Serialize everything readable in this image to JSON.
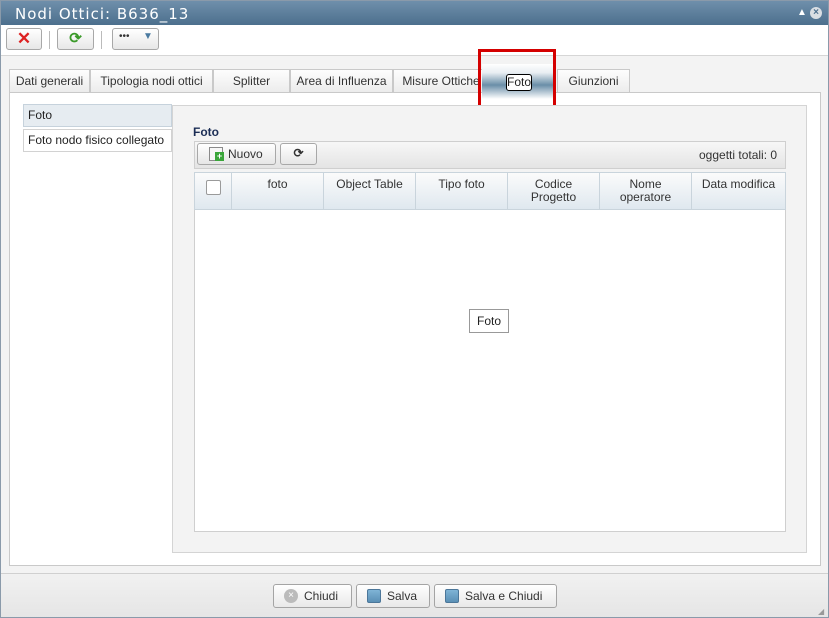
{
  "window": {
    "title": "Nodi Ottici: B636_13"
  },
  "toolbar": {
    "more_label": "•••"
  },
  "tabs": [
    {
      "label": "Dati generali"
    },
    {
      "label": "Tipologia nodi ottici"
    },
    {
      "label": "Splitter"
    },
    {
      "label": "Area di Influenza"
    },
    {
      "label": "Misure Ottiche"
    },
    {
      "label": "Foto"
    },
    {
      "label": "Giunzioni"
    }
  ],
  "sidebar": {
    "items": [
      {
        "label": "Foto"
      },
      {
        "label": "Foto nodo fisico collegato"
      }
    ]
  },
  "section": {
    "title": "Foto",
    "new_label": "Nuovo",
    "total_label": "oggetti totali: 0"
  },
  "table": {
    "columns": [
      "foto",
      "Object Table",
      "Tipo foto",
      "Codice Progetto",
      "Nome operatore",
      "Data modifica"
    ],
    "empty_label": "Foto"
  },
  "footer": {
    "close_label": "Chiudi",
    "save_label": "Salva",
    "save_close_label": "Salva e Chiudi"
  }
}
